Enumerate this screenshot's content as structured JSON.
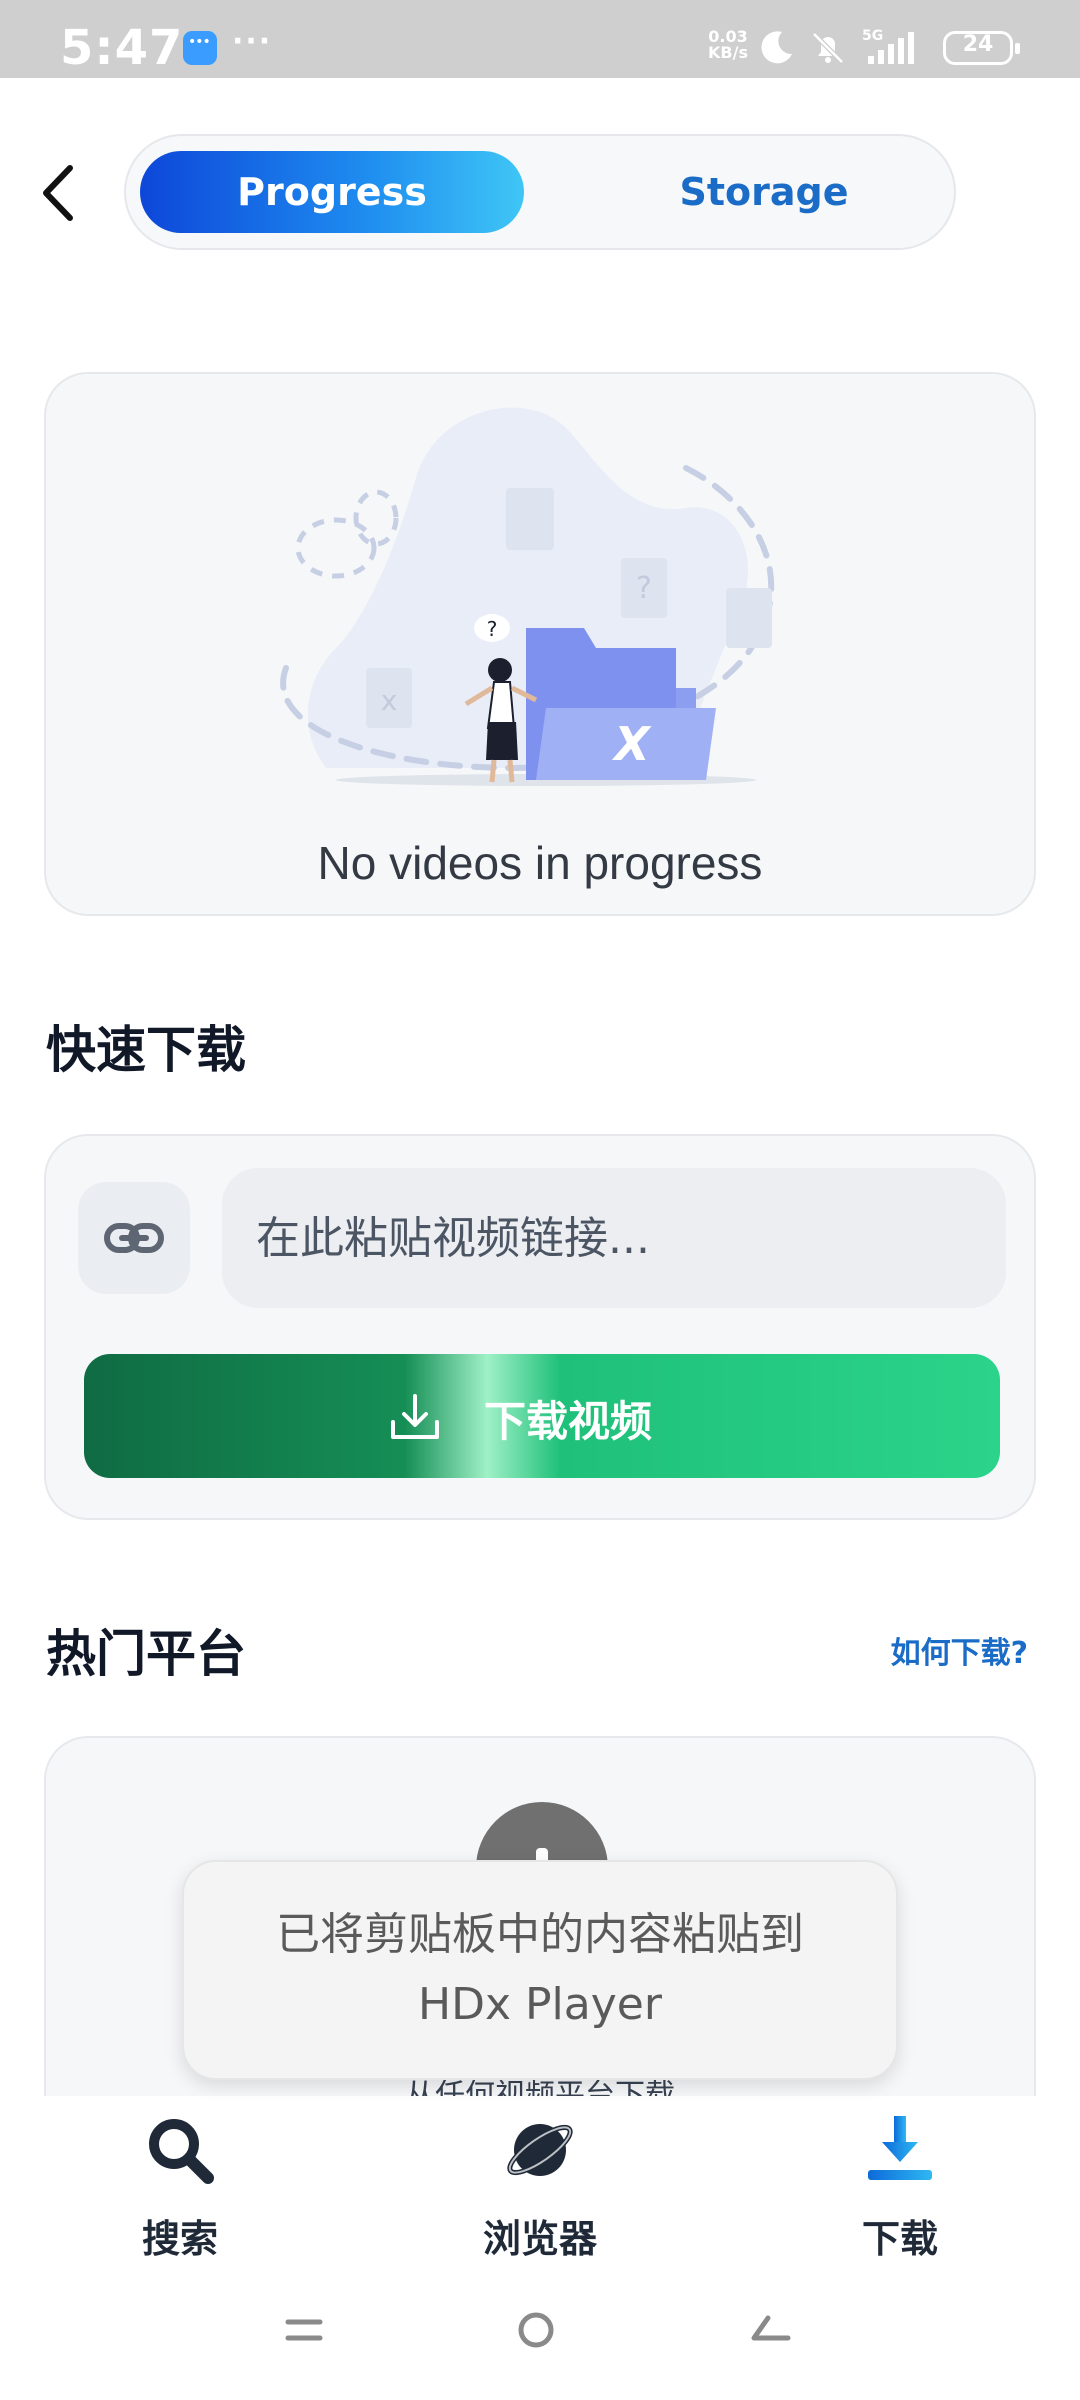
{
  "status_bar": {
    "time": "5:47",
    "more": "···",
    "speed": "0.03\nKB/s",
    "network": "5G",
    "battery": "24"
  },
  "header": {
    "tabs": [
      {
        "label": "Progress",
        "active": true
      },
      {
        "label": "Storage",
        "active": false
      }
    ]
  },
  "progress": {
    "empty_text": "No videos in progress"
  },
  "quick_download": {
    "title": "快速下载",
    "input_placeholder": "在此粘贴视频链接...",
    "button_label": "下载视频"
  },
  "platforms": {
    "title": "热门平台",
    "howto_link": "如何下载?",
    "subtitle": "从任何视频平台下载"
  },
  "toast": {
    "line1": "已将剪贴板中的内容粘贴到",
    "line2": "HDx Player"
  },
  "bottom_nav": {
    "items": [
      {
        "label": "搜索",
        "icon": "search-icon"
      },
      {
        "label": "浏览器",
        "icon": "planet-icon"
      },
      {
        "label": "下载",
        "icon": "download-icon",
        "active": true
      }
    ]
  },
  "colors": {
    "accent_blue": "#1a6cc7",
    "download_green": "#1fc07a",
    "status_bar": "#cfcfcf"
  }
}
